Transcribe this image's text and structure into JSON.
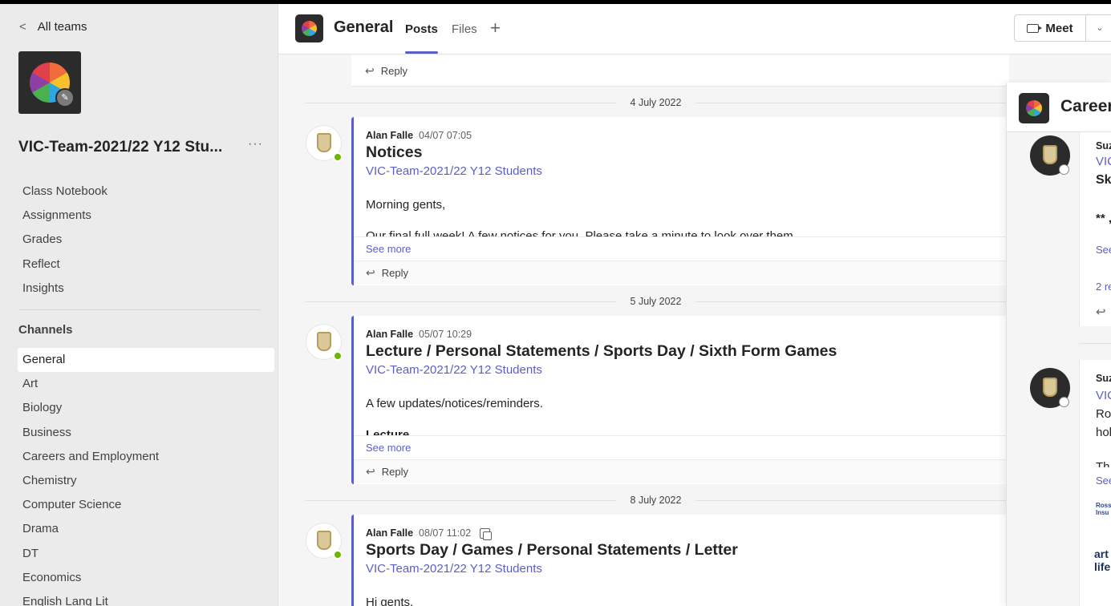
{
  "sidebar": {
    "back_label": "All teams",
    "team_name": "VIC-Team-2021/22 Y12 Stu...",
    "more_label": "···",
    "nav_items": [
      "Class Notebook",
      "Assignments",
      "Grades",
      "Reflect",
      "Insights"
    ],
    "channels_heading": "Channels",
    "channels": [
      "General",
      "Art",
      "Biology",
      "Business",
      "Careers and Employment",
      "Chemistry",
      "Computer Science",
      "Drama",
      "DT",
      "Economics",
      "English Lang Lit"
    ],
    "active_channel": "General"
  },
  "header": {
    "channel_title": "General",
    "tabs": [
      "Posts",
      "Files"
    ],
    "active_tab": "Posts",
    "add_tab": "+",
    "meet_label": "Meet",
    "meet_dropdown": "⌄"
  },
  "feed": {
    "top_reply_label": "Reply",
    "posts": [
      {
        "date": "4 July 2022",
        "author": "Alan Falle",
        "timestamp": "04/07 07:05",
        "subject": "Notices",
        "team_link": "VIC-Team-2021/22 Y12 Students",
        "body": "Morning gents,",
        "cut_text": "Our final full week! A few notices for you. Please take a minute to look over them.",
        "see_more": "See more",
        "reply": "Reply"
      },
      {
        "date": "5 July 2022",
        "author": "Alan Falle",
        "timestamp": "05/07 10:29",
        "subject": "Lecture / Personal Statements / Sports Day / Sixth Form Games",
        "team_link": "VIC-Team-2021/22 Y12 Students",
        "body": "A few updates/notices/reminders.",
        "cut_text": "Lecture",
        "see_more": "See more",
        "reply": "Reply"
      },
      {
        "date": "8 July 2022",
        "author": "Alan Falle",
        "timestamp": "08/07 11:02",
        "subject": "Sports Day / Games / Personal Statements / Letter",
        "team_link": "VIC-Team-2021/22 Y12 Students",
        "body": "Hi gents,"
      }
    ]
  },
  "overlay": {
    "title": "Careers",
    "card1": {
      "author": "Suz",
      "link": "VIC",
      "subject": "Sk",
      "body": "** ,",
      "see_more": "See",
      "replies": "2 re",
      "reply_icon": "↩"
    },
    "card2": {
      "author": "Suz",
      "link": "VIC",
      "line1": "Ro",
      "line2": "hol",
      "line3": "Th",
      "see_more": "See",
      "logo_text1": "Ross",
      "logo_text2": "Insu",
      "art1": "art",
      "art2": "life"
    }
  },
  "icons": {
    "back": "chevron-left-icon",
    "edit": "pencil-icon",
    "reply": "reply-arrow-icon",
    "video": "video-camera-icon",
    "copy": "copy-link-icon"
  },
  "colors": {
    "accent": "#5b5fc7",
    "presence_available": "#6bb700"
  }
}
